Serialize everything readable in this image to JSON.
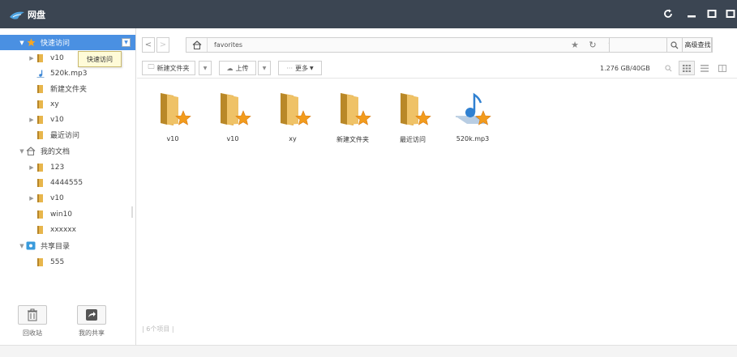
{
  "app": {
    "title": "网盘"
  },
  "window_controls": {
    "refresh_icon": "refresh-icon",
    "minimize_icon": "minimize-icon",
    "maximize_icon": "maximize-icon",
    "close_icon": "close-icon"
  },
  "sidebar": {
    "tooltip": "快速访问",
    "items": [
      {
        "label": "快速访问",
        "level": 0,
        "expand": "▼",
        "icon": "star-icon"
      },
      {
        "label": "v10",
        "level": 1,
        "expand": "▶",
        "icon": "folder-icon"
      },
      {
        "label": "520k.mp3",
        "level": 1,
        "expand": "",
        "icon": "music-icon"
      },
      {
        "label": "新建文件夹",
        "level": 1,
        "expand": "",
        "icon": "folder-icon"
      },
      {
        "label": "xy",
        "level": 1,
        "expand": "",
        "icon": "folder-icon"
      },
      {
        "label": "v10",
        "level": 1,
        "expand": "▶",
        "icon": "folder-icon"
      },
      {
        "label": "最近访问",
        "level": 1,
        "expand": "",
        "icon": "folder-icon"
      },
      {
        "label": "我的文档",
        "level": 0,
        "expand": "▼",
        "icon": "home-icon"
      },
      {
        "label": "123",
        "level": 1,
        "expand": "▶",
        "icon": "folder-icon"
      },
      {
        "label": "4444555",
        "level": 1,
        "expand": "",
        "icon": "folder-icon"
      },
      {
        "label": "v10",
        "level": 1,
        "expand": "▶",
        "icon": "folder-icon"
      },
      {
        "label": "win10",
        "level": 1,
        "expand": "",
        "icon": "folder-icon"
      },
      {
        "label": "xxxxxx",
        "level": 1,
        "expand": "",
        "icon": "folder-icon"
      },
      {
        "label": "共享目录",
        "level": 0,
        "expand": "▼",
        "icon": "share-icon"
      },
      {
        "label": "555",
        "level": 1,
        "expand": "",
        "icon": "folder-icon"
      }
    ],
    "bottom": {
      "recycle_label": "回收站",
      "myshare_label": "我的共享"
    }
  },
  "address": {
    "back": "<",
    "forward": ">",
    "path": "favorites",
    "up": "↑",
    "star": "★",
    "refresh": "↻",
    "search_placeholder": "",
    "adv_search_label": "高级查找"
  },
  "toolbar": {
    "new_folder_label": "新建文件夹",
    "upload_label": "上传",
    "more_label": "更多",
    "capacity": "1.276 GB/40GB"
  },
  "files": [
    {
      "name": "v10",
      "type": "folder"
    },
    {
      "name": "v10",
      "type": "folder"
    },
    {
      "name": "xy",
      "type": "folder"
    },
    {
      "name": "新建文件夹",
      "type": "folder"
    },
    {
      "name": "最近访问",
      "type": "folder"
    },
    {
      "name": "520k.mp3",
      "type": "audio"
    }
  ],
  "status": {
    "item_count": "| 6个项目 |"
  },
  "colors": {
    "titlebar": "#3b4552",
    "selection": "#4a90e2",
    "folder": "#e8b64c",
    "star": "#f29b1d"
  }
}
